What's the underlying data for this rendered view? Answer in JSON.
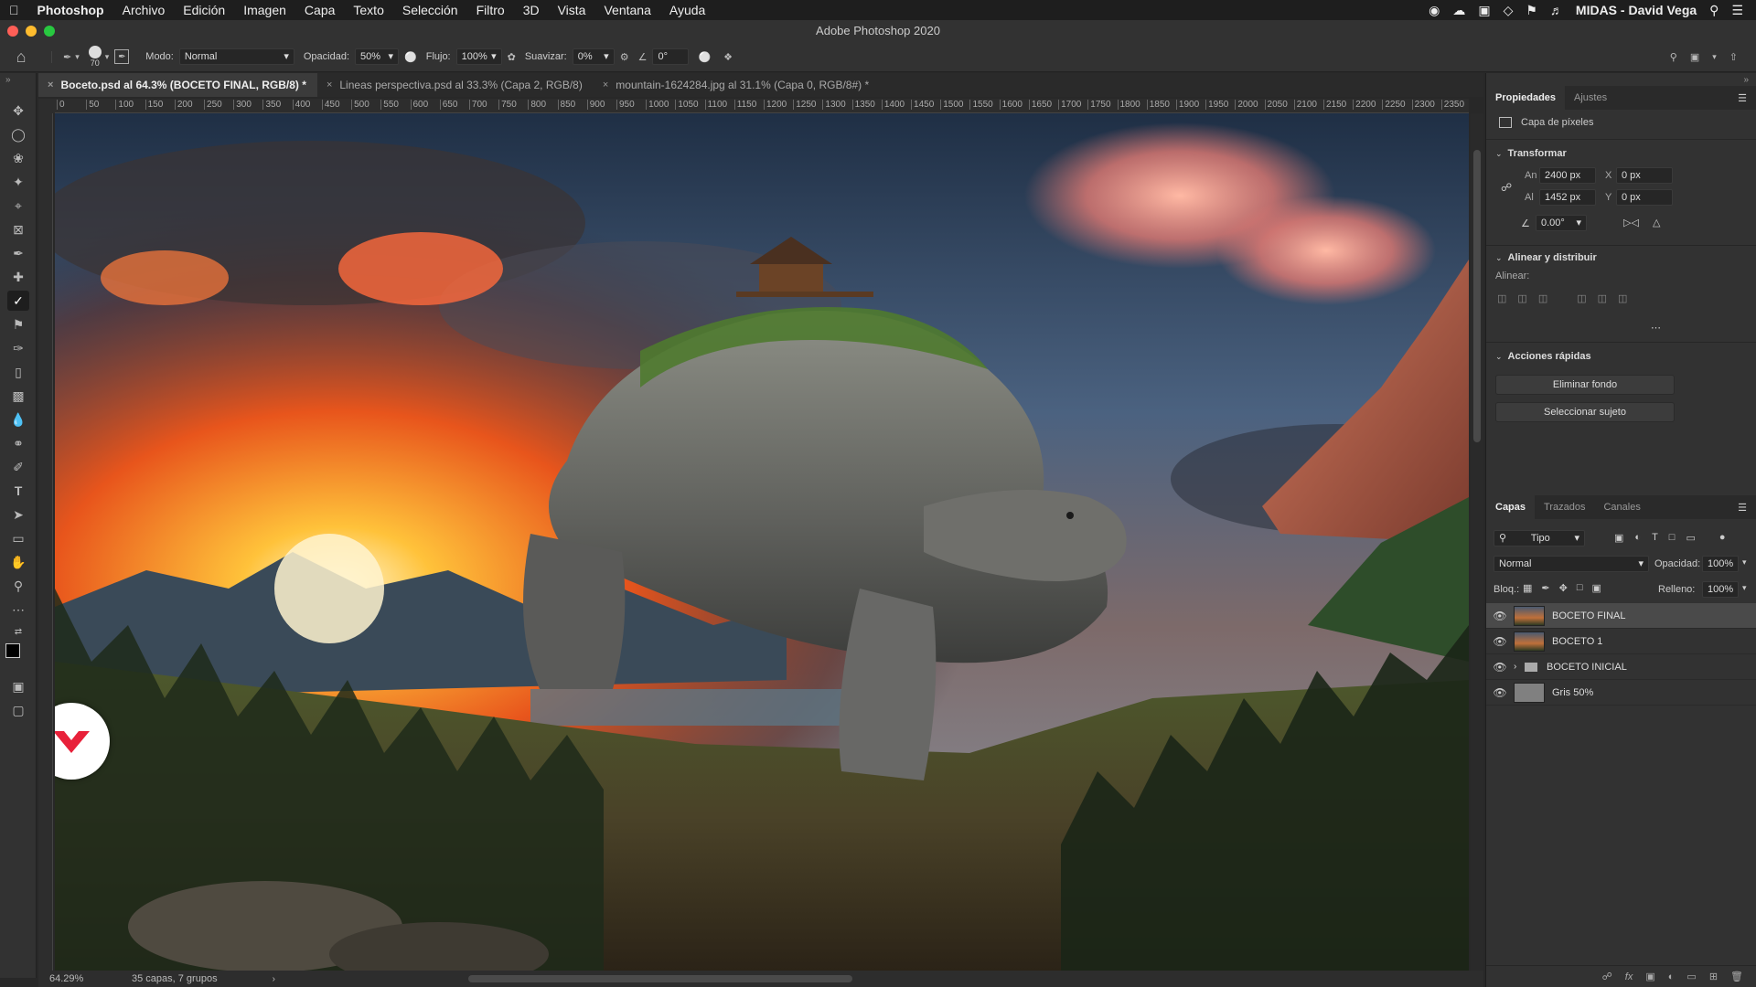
{
  "menubar": {
    "apple": "",
    "app": "Photoshop",
    "items": [
      "Archivo",
      "Edición",
      "Imagen",
      "Capa",
      "Texto",
      "Selección",
      "Filtro",
      "3D",
      "Vista",
      "Ventana",
      "Ayuda"
    ],
    "user": "MIDAS - David Vega"
  },
  "window": {
    "title": "Adobe Photoshop 2020"
  },
  "options": {
    "brush_size": "70",
    "mode_label": "Modo:",
    "mode_value": "Normal",
    "opacity_label": "Opacidad:",
    "opacity_value": "50%",
    "flow_label": "Flujo:",
    "flow_value": "100%",
    "smooth_label": "Suavizar:",
    "smooth_value": "0%",
    "angle_value": "0°"
  },
  "tabs": [
    {
      "label": "Boceto.psd al 64.3% (BOCETO FINAL, RGB/8) *",
      "active": true
    },
    {
      "label": "Lineas perspectiva.psd al 33.3% (Capa 2, RGB/8)",
      "active": false
    },
    {
      "label": "mountain-1624284.jpg al 31.1% (Capa 0, RGB/8#) *",
      "active": false
    }
  ],
  "ruler": {
    "h_ticks": [
      "0",
      "50",
      "100",
      "150",
      "200",
      "250",
      "300",
      "350",
      "400",
      "450",
      "500",
      "550",
      "600",
      "650",
      "700",
      "750",
      "800",
      "850",
      "900",
      "950",
      "1000",
      "1050",
      "1100",
      "1150",
      "1200",
      "1250",
      "1300",
      "1350",
      "1400",
      "1450",
      "1500",
      "1550",
      "1600",
      "1650",
      "1700",
      "1750",
      "1800",
      "1850",
      "1900",
      "1950",
      "2000",
      "2050",
      "2100",
      "2150",
      "2200",
      "2250",
      "2300",
      "2350"
    ]
  },
  "status": {
    "zoom": "64.29%",
    "info": "35 capas, 7 grupos"
  },
  "properties": {
    "tab_properties": "Propiedades",
    "tab_adjust": "Ajustes",
    "layer_type": "Capa de píxeles",
    "transform_title": "Transformar",
    "w_label": "An",
    "w_value": "2400 px",
    "h_label": "Al",
    "h_value": "1452 px",
    "x_label": "X",
    "x_value": "0 px",
    "y_label": "Y",
    "y_value": "0 px",
    "angle_value": "0.00°",
    "align_title": "Alinear y distribuir",
    "align_label": "Alinear:",
    "quick_title": "Acciones rápidas",
    "btn_remove_bg": "Eliminar fondo",
    "btn_select_subject": "Seleccionar sujeto"
  },
  "layers_panel": {
    "tab_layers": "Capas",
    "tab_paths": "Trazados",
    "tab_channels": "Canales",
    "filter_kind": "Tipo",
    "blend_mode": "Normal",
    "opacity_label": "Opacidad:",
    "opacity_value": "100%",
    "lock_label": "Bloq.:",
    "fill_label": "Relleno:",
    "fill_value": "100%",
    "layers": [
      {
        "name": "BOCETO FINAL",
        "selected": true,
        "kind": "image"
      },
      {
        "name": "BOCETO 1",
        "selected": false,
        "kind": "image"
      },
      {
        "name": "BOCETO INICIAL",
        "selected": false,
        "kind": "group"
      },
      {
        "name": "Gris 50%",
        "selected": false,
        "kind": "gray"
      }
    ]
  },
  "colors": {
    "accent": "#e8213a",
    "panel": "#323232",
    "selected_row": "#4a4a4a"
  }
}
